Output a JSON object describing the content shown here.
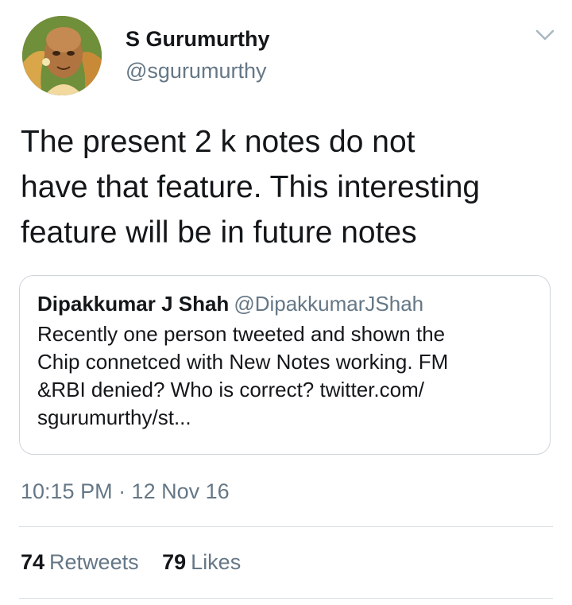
{
  "author": {
    "name": "S Gurumurthy",
    "handle": "@sgurumurthy",
    "avatar_icon": "profile-photo"
  },
  "tweet": {
    "lines": [
      "The present 2 k notes do not",
      "have that feature. This interesting",
      "feature will be in future notes"
    ]
  },
  "quoted_tweet": {
    "name": "Dipakkumar J Shah",
    "handle": "@DipakkumarJShah",
    "lines": [
      "Recently one person tweeted and shown the",
      "Chip connetced with New Notes working. FM",
      "&RBI denied? Who is correct? twitter.com/",
      "sgurumurthy/st..."
    ]
  },
  "timestamp": "10:15 PM · 12 Nov 16",
  "stats": {
    "retweets_count": "74",
    "retweets_label": "Retweets",
    "likes_count": "79",
    "likes_label": "Likes"
  },
  "colors": {
    "text": "#14171a",
    "secondary": "#657786",
    "border": "#ccd6dd",
    "background": "#ffffff"
  }
}
